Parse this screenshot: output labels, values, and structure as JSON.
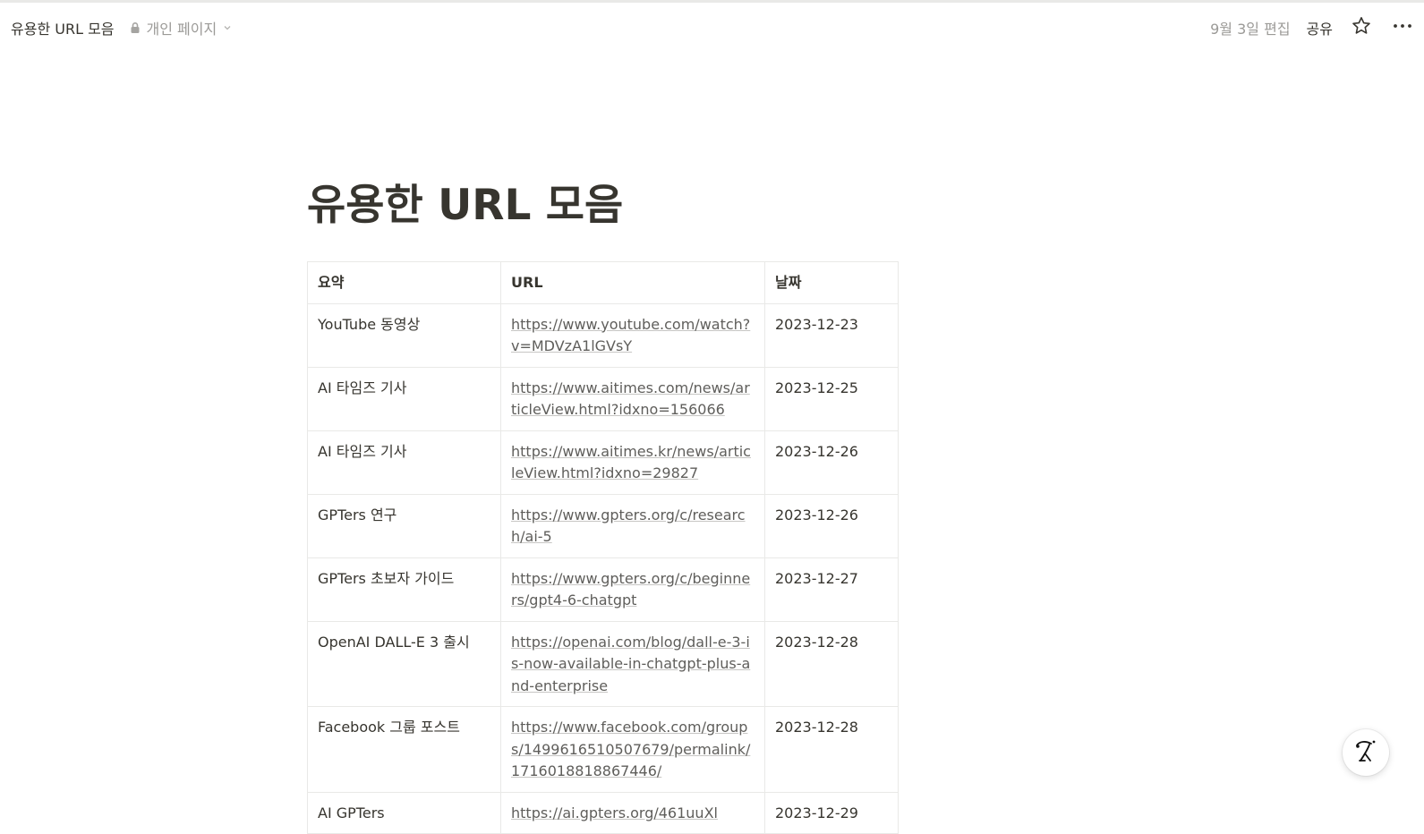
{
  "topbar": {
    "title": "유용한 URL 모음",
    "privacy_label": "개인 페이지",
    "edited": "9월 3일 편집",
    "share_label": "공유"
  },
  "page": {
    "title": "유용한 URL 모음"
  },
  "table": {
    "headers": [
      "요약",
      "URL",
      "날짜"
    ],
    "rows": [
      {
        "summary": "YouTube 동영상",
        "url": "https://www.youtube.com/watch?v=MDVzA1lGVsY",
        "date": "2023-12-23"
      },
      {
        "summary": "AI 타임즈 기사",
        "url": "https://www.aitimes.com/news/articleView.html?idxno=156066",
        "date": "2023-12-25"
      },
      {
        "summary": "AI 타임즈 기사",
        "url": "https://www.aitimes.kr/news/articleView.html?idxno=29827",
        "date": "2023-12-26"
      },
      {
        "summary": "GPTers 연구",
        "url": "https://www.gpters.org/c/research/ai-5",
        "date": "2023-12-26"
      },
      {
        "summary": "GPTers 초보자 가이드",
        "url": "https://www.gpters.org/c/beginners/gpt4-6-chatgpt",
        "date": "2023-12-27"
      },
      {
        "summary": "OpenAI DALL-E 3 출시",
        "url": "https://openai.com/blog/dall-e-3-is-now-available-in-chatgpt-plus-and-enterprise",
        "date": "2023-12-28"
      },
      {
        "summary": "Facebook 그룹 포스트",
        "url": "https://www.facebook.com/groups/1499616510507679/permalink/1716018818867446/",
        "date": "2023-12-28"
      },
      {
        "summary": "AI GPTers",
        "url": "https://ai.gpters.org/461uuXl",
        "date": "2023-12-29"
      }
    ]
  },
  "icons": {
    "privacy": "lock-icon",
    "privacy_menu": "chevron-down-icon",
    "favorite": "star-icon",
    "more": "more-horizontal-icon",
    "assistant": "notion-ai-icon"
  }
}
